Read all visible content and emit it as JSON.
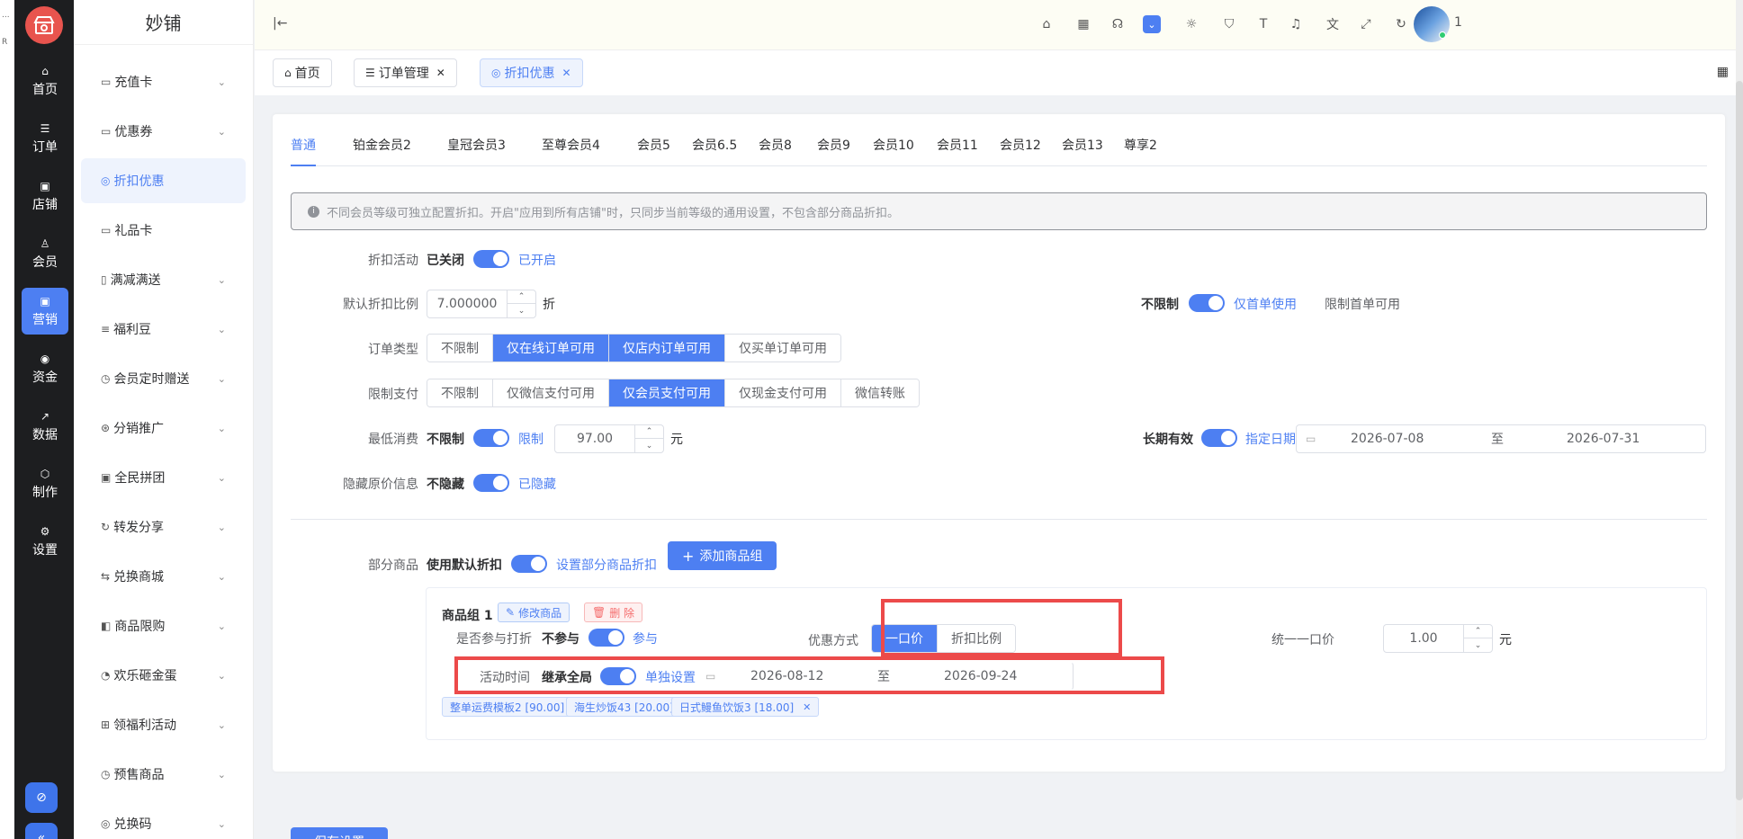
{
  "left_strip": {
    "t1": "...",
    "t2": "R"
  },
  "rail": {
    "logo_icon": "store-icon",
    "items": [
      {
        "label": "首页",
        "icon": "⌂"
      },
      {
        "label": "订单",
        "icon": "☰"
      },
      {
        "label": "店铺",
        "icon": "▣"
      },
      {
        "label": "会员",
        "icon": "♙"
      },
      {
        "label": "营销",
        "icon": "▣",
        "active": true
      },
      {
        "label": "资金",
        "icon": "◉"
      },
      {
        "label": "数据",
        "icon": "↗"
      },
      {
        "label": "制作",
        "icon": "⬡"
      },
      {
        "label": "设置",
        "icon": "⚙"
      }
    ],
    "bottom_icons": [
      "eye-off-icon",
      "collapse-icon"
    ]
  },
  "submenu": {
    "title": "妙铺",
    "items": [
      {
        "label": "充值卡",
        "icon": "▭",
        "chevron": true
      },
      {
        "label": "优惠券",
        "icon": "▭",
        "chevron": true
      },
      {
        "label": "折扣优惠",
        "icon": "◎",
        "chevron": false,
        "active": true
      },
      {
        "label": "礼品卡",
        "icon": "▭",
        "chevron": false
      },
      {
        "label": "满减满送",
        "icon": "▯",
        "chevron": true
      },
      {
        "label": "福利豆",
        "icon": "≡",
        "chevron": true
      },
      {
        "label": "会员定时赠送",
        "icon": "◷",
        "chevron": true
      },
      {
        "label": "分销推广",
        "icon": "⊛",
        "chevron": true
      },
      {
        "label": "全民拼团",
        "icon": "▣",
        "chevron": true
      },
      {
        "label": "转发分享",
        "icon": "↻",
        "chevron": true
      },
      {
        "label": "兑换商城",
        "icon": "⇆",
        "chevron": true
      },
      {
        "label": "商品限购",
        "icon": "◧",
        "chevron": true
      },
      {
        "label": "欢乐砸金蛋",
        "icon": "◔",
        "chevron": true
      },
      {
        "label": "领福利活动",
        "icon": "⊞",
        "chevron": true
      },
      {
        "label": "预售商品",
        "icon": "◷",
        "chevron": true
      },
      {
        "label": "兑换码",
        "icon": "◎",
        "chevron": true
      }
    ]
  },
  "topbar": {
    "collapse_icon": "|←",
    "icons": [
      {
        "name": "home-icon",
        "glyph": "⌂"
      },
      {
        "name": "qrcode-icon",
        "glyph": "▦"
      },
      {
        "name": "headset-icon",
        "glyph": "☊"
      },
      {
        "name": "dropdown-icon",
        "glyph": "⌄",
        "highlight": true
      },
      {
        "name": "sun-icon",
        "glyph": "☼"
      },
      {
        "name": "shirt-icon",
        "glyph": "⛉"
      },
      {
        "name": "font-size-icon",
        "glyph": "T"
      },
      {
        "name": "bell-icon",
        "glyph": "♫"
      },
      {
        "name": "translate-icon",
        "glyph": "文"
      },
      {
        "name": "fullscreen-icon",
        "glyph": "⤢"
      },
      {
        "name": "refresh-icon",
        "glyph": "↻"
      }
    ],
    "user_label": "1"
  },
  "tabs": [
    {
      "label": "首页",
      "icon": "⌂",
      "closable": false
    },
    {
      "label": "订单管理",
      "icon": "☰",
      "closable": true
    },
    {
      "label": "折扣优惠",
      "icon": "◎",
      "closable": true,
      "active": true
    }
  ],
  "level_tabs": [
    "普通",
    "铂金会员2",
    "皇冠会员3",
    "至尊会员4",
    "会员5",
    "会员6.5",
    "会员8",
    "会员9",
    "会员10",
    "会员11",
    "会员12",
    "会员13",
    "尊享2"
  ],
  "notice": "不同会员等级可独立配置折扣。开启\"应用到所有店铺\"时，只同步当前等级的通用设置，不包含部分商品折扣。",
  "form": {
    "discount_activity": {
      "label": "折扣活动",
      "off": "已关闭",
      "on": "已开启"
    },
    "default_ratio": {
      "label": "默认折扣比例",
      "value": "7.000000",
      "unit": "折"
    },
    "first_order": {
      "label": "限制首单可用",
      "off": "不限制",
      "on": "仅首单使用"
    },
    "order_type": {
      "label": "订单类型",
      "options": [
        "不限制",
        "仅在线订单可用",
        "仅店内订单可用",
        "仅买单订单可用"
      ],
      "selected": [
        1,
        2
      ]
    },
    "pay_limit": {
      "label": "限制支付",
      "options": [
        "不限制",
        "仅微信支付可用",
        "仅会员支付可用",
        "仅现金支付可用",
        "微信转账"
      ],
      "selected": [
        2
      ]
    },
    "min_spend": {
      "label": "最低消费",
      "off": "不限制",
      "on": "限制",
      "value": "97.00",
      "unit": "元"
    },
    "activity_time": {
      "label": "活动时间",
      "off": "长期有效",
      "on": "指定日期",
      "start": "2026-07-08",
      "sep": "至",
      "end": "2026-07-31"
    },
    "hide_price": {
      "label": "隐藏原价信息",
      "off": "不隐藏",
      "on": "已隐藏"
    },
    "partial_goods": {
      "label": "部分商品",
      "off": "使用默认折扣",
      "on": "设置部分商品折扣",
      "add_button": "添加商品组"
    }
  },
  "group": {
    "title": "商品组 1",
    "edit_button": "修改商品",
    "delete_button": "删 除",
    "participate": {
      "label": "是否参与打折",
      "off": "不参与",
      "on": "参与"
    },
    "discount_mode": {
      "label": "优惠方式",
      "options": [
        "一口价",
        "折扣比例"
      ],
      "selected": 0
    },
    "unified_price": {
      "label": "统一一口价",
      "value": "1.00",
      "unit": "元"
    },
    "time": {
      "label": "活动时间",
      "off": "继承全局",
      "on": "单独设置",
      "start": "2026-08-12",
      "sep": "至",
      "end": "2026-09-24"
    },
    "tags": [
      "整单运费模板2 [90.00]",
      "海生炒饭43 [20.00]",
      "日式鳗鱼饮饭3 [18.00]"
    ]
  },
  "save_button": "保存设置",
  "colors": {
    "primary": "#4d7ff2",
    "rail_bg": "#1d1e20",
    "highlight_box": "#ec4a4a"
  }
}
